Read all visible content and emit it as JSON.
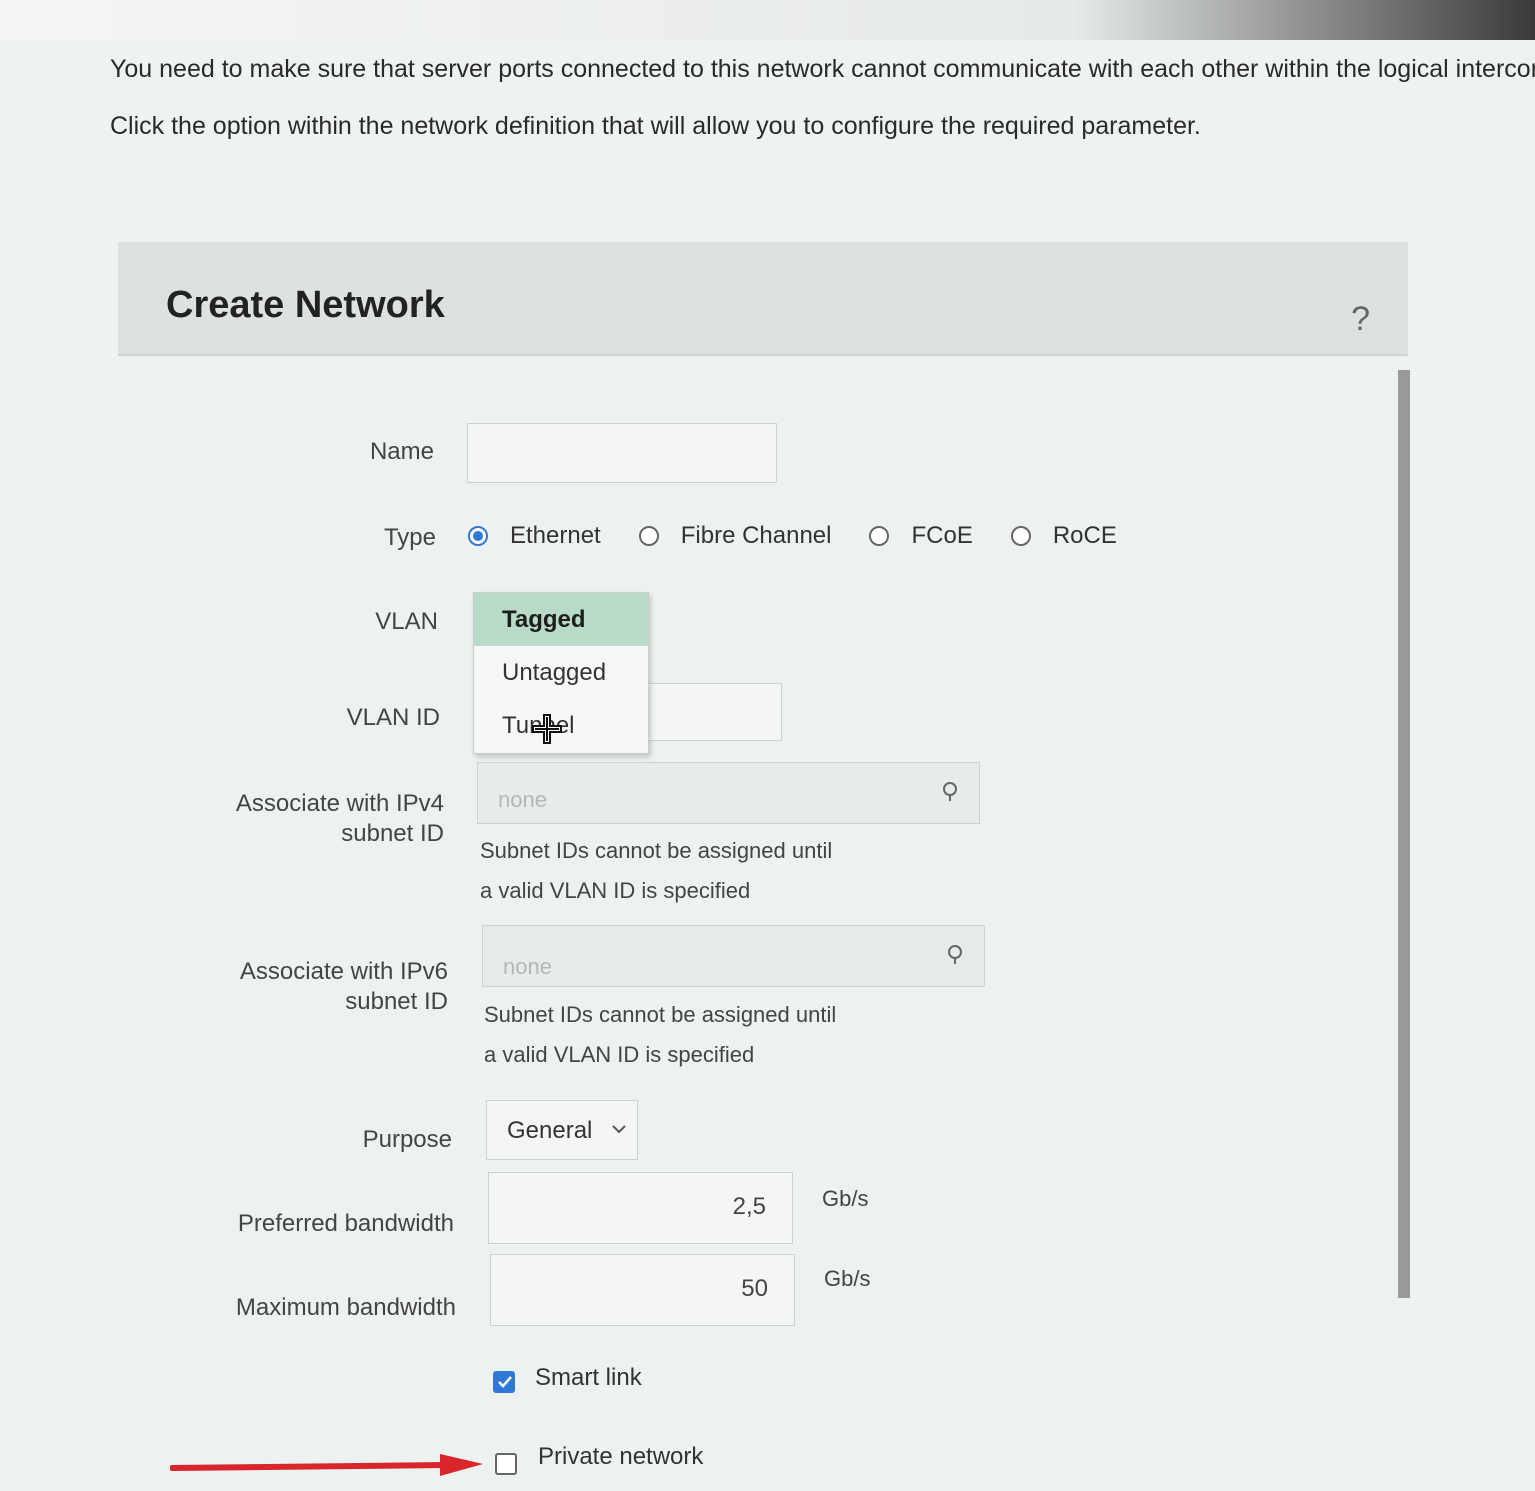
{
  "instructions": {
    "line1": "You need to make sure that server ports connected to this network cannot communicate with each other within the logical interconnect.",
    "line2": "Click the option within the network definition that will allow you to configure the required parameter."
  },
  "dialog": {
    "title": "Create Network",
    "help": "?"
  },
  "form": {
    "name": {
      "label": "Name",
      "value": ""
    },
    "type": {
      "label": "Type",
      "options": [
        "Ethernet",
        "Fibre Channel",
        "FCoE",
        "RoCE"
      ],
      "selected": "Ethernet"
    },
    "vlan": {
      "label": "VLAN",
      "options": [
        "Tagged",
        "Untagged",
        "Tunnel"
      ],
      "selected": "Tagged"
    },
    "vlan_id": {
      "label": "VLAN ID",
      "value": ""
    },
    "ipv4": {
      "label_line1": "Associate with IPv4",
      "label_line2": "subnet ID",
      "placeholder": "none",
      "note_line1": "Subnet IDs cannot be assigned until",
      "note_line2": "a valid VLAN ID is specified"
    },
    "ipv6": {
      "label_line1": "Associate with IPv6",
      "label_line2": "subnet ID",
      "placeholder": "none",
      "note_line1": "Subnet IDs cannot be assigned until",
      "note_line2": "a valid VLAN ID is specified"
    },
    "purpose": {
      "label": "Purpose",
      "value": "General"
    },
    "preferred_bandwidth": {
      "label": "Preferred bandwidth",
      "value": "2,5",
      "unit": "Gb/s"
    },
    "maximum_bandwidth": {
      "label": "Maximum bandwidth",
      "value": "50",
      "unit": "Gb/s"
    },
    "smart_link": {
      "label": "Smart link",
      "checked": true
    },
    "private_network": {
      "label": "Private network",
      "checked": false
    }
  },
  "colors": {
    "accent": "#2f78d6",
    "menu_selected": "#b8dbc8",
    "annotation_arrow": "#d8262b"
  },
  "icons": [
    "search-icon",
    "chevron-down-icon",
    "check-icon",
    "crosshair-cursor-icon",
    "arrow-right-icon"
  ]
}
